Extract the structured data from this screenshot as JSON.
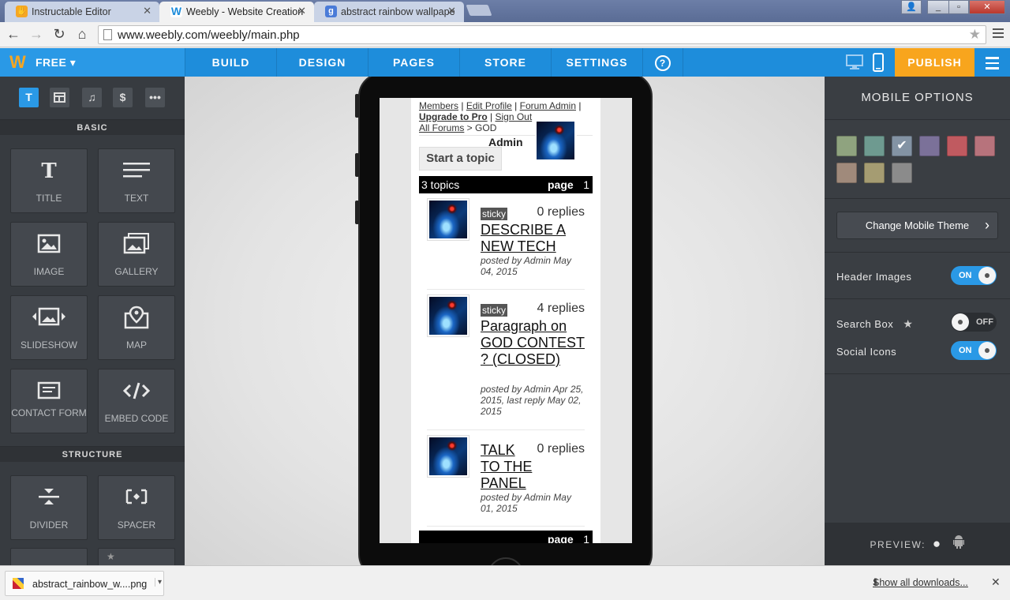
{
  "browser": {
    "tabs": [
      {
        "title": "Instructable Editor",
        "favicon": "instructables-icon",
        "favicon_color": "#f5a623"
      },
      {
        "title": "Weebly - Website Creation",
        "favicon": "weebly-icon",
        "favicon_color": "#1e8ddb"
      },
      {
        "title": "abstract rainbow wallpape",
        "favicon": "google-icon",
        "favicon_color": "#4a7bd8"
      }
    ],
    "url": "www.weebly.com/weebly/main.php"
  },
  "weebly": {
    "plan": "FREE",
    "nav": [
      "BUILD",
      "DESIGN",
      "PAGES",
      "STORE",
      "SETTINGS"
    ],
    "help": "?",
    "publish": "PUBLISH",
    "accent": "#1e8ddb",
    "publish_color": "#f8a51d"
  },
  "left": {
    "category_icons": [
      "T",
      "layout",
      "music",
      "$",
      "..."
    ],
    "basic_label": "BASIC",
    "structure_label": "STRUCTURE",
    "elements": [
      {
        "label": "TITLE",
        "icon": "title-icon"
      },
      {
        "label": "TEXT",
        "icon": "text-icon"
      },
      {
        "label": "IMAGE",
        "icon": "image-icon"
      },
      {
        "label": "GALLERY",
        "icon": "gallery-icon"
      },
      {
        "label": "SLIDESHOW",
        "icon": "slideshow-icon"
      },
      {
        "label": "MAP",
        "icon": "map-icon"
      },
      {
        "label": "CONTACT FORM",
        "icon": "form-icon"
      },
      {
        "label": "EMBED CODE",
        "icon": "code-icon"
      }
    ],
    "structure_elements": [
      {
        "label": "DIVIDER",
        "icon": "divider-icon"
      },
      {
        "label": "SPACER",
        "icon": "spacer-icon"
      }
    ]
  },
  "forum": {
    "links": {
      "members": "Members",
      "edit_profile": "Edit Profile",
      "forum_admin": "Forum Admin",
      "upgrade": "Upgrade to Pro",
      "sign_out": "Sign Out",
      "all_forums": "All Forums",
      "crumb_sep": " > ",
      "current": "GOD"
    },
    "user": "Admin",
    "start_topic": "Start a topic",
    "topic_count": "3 topics",
    "page_label": "page",
    "page_num": "1",
    "topics": [
      {
        "sticky": "sticky",
        "replies": "0 replies",
        "title": "DESCRIBE A NEW TECH",
        "meta": "posted by Admin May 04, 2015"
      },
      {
        "sticky": "sticky",
        "replies": "4 replies",
        "title": "Paragraph on GOD CONTEST ? (CLOSED)",
        "meta": "posted by Admin Apr 25, 2015, last reply May 02, 2015"
      },
      {
        "sticky": "",
        "replies": "0 replies",
        "title": "TALK TO THE PANEL",
        "meta": "posted by Admin May 01, 2015"
      }
    ]
  },
  "right": {
    "title": "MOBILE OPTIONS",
    "swatches": [
      "#8fa37f",
      "#6e9a90",
      "#8393a4",
      "#7b7199",
      "#c05a60",
      "#b7737c",
      "#a08a7b",
      "#a59c72",
      "#8b8b8b"
    ],
    "selected_swatch": 2,
    "change_theme": "Change Mobile Theme",
    "header_images": {
      "label": "Header Images",
      "state": "ON"
    },
    "search_box": {
      "label": "Search Box",
      "state": "OFF"
    },
    "social_icons": {
      "label": "Social Icons",
      "state": "ON"
    },
    "preview": "PREVIEW:"
  },
  "downloads": {
    "file": "abstract_rainbow_w....png",
    "show_all": "Show all downloads..."
  }
}
